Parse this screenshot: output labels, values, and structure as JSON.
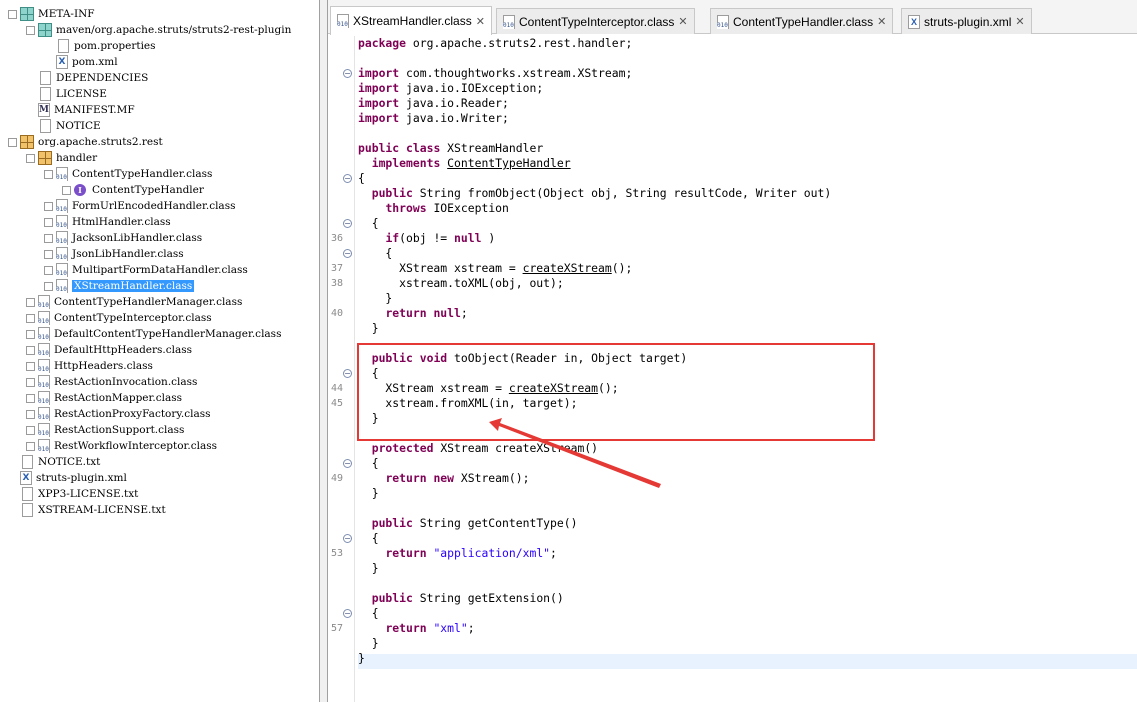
{
  "tree": [
    {
      "label": "META-INF",
      "icon": "package-folder-icon",
      "toggle": "−"
    },
    {
      "label": "maven/org.apache.struts/struts2-rest-plugin",
      "icon": "package-folder-icon",
      "toggle": "−"
    },
    {
      "label": "pom.properties",
      "icon": "file-icon",
      "toggle": ""
    },
    {
      "label": "pom.xml",
      "icon": "xml-file-icon",
      "toggle": ""
    },
    {
      "label": "DEPENDENCIES",
      "icon": "file-icon",
      "toggle": ""
    },
    {
      "label": "LICENSE",
      "icon": "file-icon",
      "toggle": ""
    },
    {
      "label": "MANIFEST.MF",
      "icon": "manifest-file-icon",
      "toggle": ""
    },
    {
      "label": "NOTICE",
      "icon": "file-icon",
      "toggle": ""
    },
    {
      "label": "org.apache.struts2.rest",
      "icon": "package-icon",
      "toggle": "−"
    },
    {
      "label": "handler",
      "icon": "package-icon",
      "toggle": "−"
    },
    {
      "label": "ContentTypeHandler.class",
      "icon": "class-file-icon",
      "toggle": "−"
    },
    {
      "label": "ContentTypeHandler",
      "icon": "interface-icon",
      "toggle": "+"
    },
    {
      "label": "FormUrlEncodedHandler.class",
      "icon": "class-file-icon",
      "toggle": "+"
    },
    {
      "label": "HtmlHandler.class",
      "icon": "class-file-icon",
      "toggle": "+"
    },
    {
      "label": "JacksonLibHandler.class",
      "icon": "class-file-icon",
      "toggle": "+"
    },
    {
      "label": "JsonLibHandler.class",
      "icon": "class-file-icon",
      "toggle": "+"
    },
    {
      "label": "MultipartFormDataHandler.class",
      "icon": "class-file-icon",
      "toggle": "+"
    },
    {
      "label": "XStreamHandler.class",
      "icon": "class-file-icon",
      "toggle": "+",
      "selected": true
    },
    {
      "label": "ContentTypeHandlerManager.class",
      "icon": "class-file-icon",
      "toggle": "+"
    },
    {
      "label": "ContentTypeInterceptor.class",
      "icon": "class-file-icon",
      "toggle": "+"
    },
    {
      "label": "DefaultContentTypeHandlerManager.class",
      "icon": "class-file-icon",
      "toggle": "+"
    },
    {
      "label": "DefaultHttpHeaders.class",
      "icon": "class-file-icon",
      "toggle": "+"
    },
    {
      "label": "HttpHeaders.class",
      "icon": "class-file-icon",
      "toggle": "+"
    },
    {
      "label": "RestActionInvocation.class",
      "icon": "class-file-icon",
      "toggle": "+"
    },
    {
      "label": "RestActionMapper.class",
      "icon": "class-file-icon",
      "toggle": "+"
    },
    {
      "label": "RestActionProxyFactory.class",
      "icon": "class-file-icon",
      "toggle": "+"
    },
    {
      "label": "RestActionSupport.class",
      "icon": "class-file-icon",
      "toggle": "+"
    },
    {
      "label": "RestWorkflowInterceptor.class",
      "icon": "class-file-icon",
      "toggle": "+"
    },
    {
      "label": "NOTICE.txt",
      "icon": "file-icon",
      "toggle": ""
    },
    {
      "label": "struts-plugin.xml",
      "icon": "xml-file-icon",
      "toggle": ""
    },
    {
      "label": "XPP3-LICENSE.txt",
      "icon": "file-icon",
      "toggle": ""
    },
    {
      "label": "XSTREAM-LICENSE.txt",
      "icon": "file-icon",
      "toggle": ""
    }
  ],
  "tabs": [
    {
      "label": "XStreamHandler.class",
      "icon": "class-file-icon",
      "active": true
    },
    {
      "label": "ContentTypeInterceptor.class",
      "icon": "class-file-icon",
      "active": false
    },
    {
      "label": "ContentTypeHandler.class",
      "icon": "class-file-icon",
      "active": false
    },
    {
      "label": "struts-plugin.xml",
      "icon": "xml-file-icon",
      "active": false
    }
  ],
  "tab_close_glyph": "✕",
  "code_lines": [
    {
      "t": [
        [
          "kw",
          "package"
        ],
        [
          "",
          "org.apache.struts2.rest.handler;"
        ]
      ]
    },
    {
      "t": []
    },
    {
      "t": [
        [
          "kw",
          "import"
        ],
        [
          "",
          "com.thoughtworks.xstream.XStream;"
        ]
      ],
      "fold": "−"
    },
    {
      "t": [
        [
          "kw",
          "import"
        ],
        [
          "",
          "java.io.IOException;"
        ]
      ]
    },
    {
      "t": [
        [
          "kw",
          "import"
        ],
        [
          "",
          "java.io.Reader;"
        ]
      ]
    },
    {
      "t": [
        [
          "kw",
          "import"
        ],
        [
          "",
          "java.io.Writer;"
        ]
      ]
    },
    {
      "t": []
    },
    {
      "t": [
        [
          "kw",
          "public"
        ],
        [
          "",
          ""
        ],
        [
          "kw",
          "class"
        ],
        [
          "",
          "XStreamHandler"
        ]
      ]
    },
    {
      "t": [
        [
          "",
          "  "
        ],
        [
          "kw",
          "implements"
        ],
        [
          "u",
          "ContentTypeHandler"
        ]
      ]
    },
    {
      "t": [
        [
          "",
          "{"
        ]
      ],
      "fold": "−"
    },
    {
      "t": [
        [
          "",
          "  "
        ],
        [
          "kw",
          "public"
        ],
        [
          "",
          "String fromObject(Object obj, String resultCode, Writer out)"
        ]
      ]
    },
    {
      "t": [
        [
          "",
          "    "
        ],
        [
          "kw",
          "throws"
        ],
        [
          "",
          "IOException"
        ]
      ]
    },
    {
      "t": [
        [
          "",
          "  {"
        ]
      ],
      "fold": "−"
    },
    {
      "t": [
        [
          "",
          "    "
        ],
        [
          "kw",
          "if"
        ],
        [
          "",
          "(obj != "
        ],
        [
          "kw",
          "null"
        ],
        [
          "",
          ")"
        ]
      ],
      "ln": "36"
    },
    {
      "t": [
        [
          "",
          "    {"
        ]
      ],
      "fold": "−"
    },
    {
      "t": [
        [
          "",
          "      XStream xstream = "
        ],
        [
          "u",
          "createXStream"
        ],
        [
          "",
          "();"
        ]
      ],
      "ln": "37"
    },
    {
      "t": [
        [
          "",
          "      xstream.toXML(obj, out);"
        ]
      ],
      "ln": "38"
    },
    {
      "t": [
        [
          "",
          "    }"
        ]
      ]
    },
    {
      "t": [
        [
          "",
          "    "
        ],
        [
          "kw",
          "return null"
        ],
        [
          "",
          ";"
        ]
      ],
      "ln": "40"
    },
    {
      "t": [
        [
          "",
          "  }"
        ]
      ]
    },
    {
      "t": []
    },
    {
      "t": [
        [
          "",
          "  "
        ],
        [
          "kw",
          "public void"
        ],
        [
          "",
          "toObject(Reader in, Object target)"
        ]
      ]
    },
    {
      "t": [
        [
          "",
          "  {"
        ]
      ],
      "fold": "−"
    },
    {
      "t": [
        [
          "",
          "    XStream xstream = "
        ],
        [
          "u",
          "createXStream"
        ],
        [
          "",
          "();"
        ]
      ],
      "ln": "44"
    },
    {
      "t": [
        [
          "",
          "    xstream.fromXML(in, target);"
        ]
      ],
      "ln": "45"
    },
    {
      "t": [
        [
          "",
          "  }"
        ]
      ]
    },
    {
      "t": []
    },
    {
      "t": [
        [
          "",
          "  "
        ],
        [
          "kw",
          "protected"
        ],
        [
          "",
          "XStream createXStream()"
        ]
      ]
    },
    {
      "t": [
        [
          "",
          "  {"
        ]
      ],
      "fold": "−"
    },
    {
      "t": [
        [
          "",
          "    "
        ],
        [
          "kw",
          "return new"
        ],
        [
          "",
          "XStream();"
        ]
      ],
      "ln": "49"
    },
    {
      "t": [
        [
          "",
          "  }"
        ]
      ]
    },
    {
      "t": []
    },
    {
      "t": [
        [
          "",
          "  "
        ],
        [
          "kw",
          "public"
        ],
        [
          "",
          "String getContentType()"
        ]
      ]
    },
    {
      "t": [
        [
          "",
          "  {"
        ]
      ],
      "fold": "−"
    },
    {
      "t": [
        [
          "",
          "    "
        ],
        [
          "kw",
          "return"
        ],
        [
          "str",
          "\"application/xml\""
        ],
        [
          "",
          ";"
        ]
      ],
      "ln": "53"
    },
    {
      "t": [
        [
          "",
          "  }"
        ]
      ]
    },
    {
      "t": []
    },
    {
      "t": [
        [
          "",
          "  "
        ],
        [
          "kw",
          "public"
        ],
        [
          "",
          "String getExtension()"
        ]
      ]
    },
    {
      "t": [
        [
          "",
          "  {"
        ]
      ],
      "fold": "−"
    },
    {
      "t": [
        [
          "",
          "    "
        ],
        [
          "kw",
          "return"
        ],
        [
          "str",
          "\"xml\""
        ],
        [
          "",
          ";"
        ]
      ],
      "ln": "57"
    },
    {
      "t": [
        [
          "",
          "  }"
        ]
      ]
    },
    {
      "t": [
        [
          "",
          "}"
        ]
      ]
    }
  ],
  "colors": {
    "keyword": "#7f0055",
    "string": "#2a00ff",
    "selection": "#3399ff",
    "annotation": "#e53935"
  }
}
